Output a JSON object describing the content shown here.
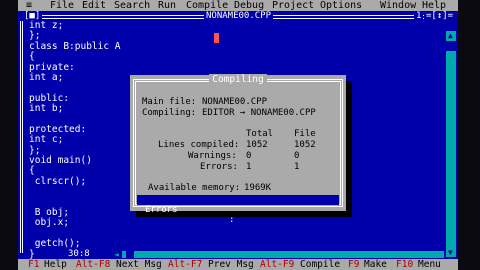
{
  "menu": {
    "system": "≡",
    "items": [
      "File",
      "Edit",
      "Search",
      "Run",
      "Compile",
      "Debug",
      "Project",
      "Options",
      "Window",
      "Help"
    ]
  },
  "editor": {
    "left_marker": "[■]",
    "filename": "NONAME00.CPP",
    "window_number": "1",
    "right_marker": "=[↕]=",
    "cursor_position": "30:8",
    "code_lines": [
      "int z;",
      "};",
      "class B:public A",
      "{",
      "private:",
      "int a;",
      "",
      "public:",
      "int b;",
      "",
      "protected:",
      "int c;",
      "};",
      "void main()",
      "{",
      " clrscr();",
      "",
      "",
      " B obj;",
      " obj.x;",
      "",
      " getch();",
      "}"
    ]
  },
  "dialog": {
    "title": "Compiling",
    "main_file_label": "Main file:",
    "main_file_value": "NONAME00.CPP",
    "compiling_label": "Compiling:",
    "compiling_value": "EDITOR → NONAME00.CPP",
    "col_total": "Total",
    "col_file": "File",
    "lines_label": "Lines compiled:",
    "lines_total": "1052",
    "lines_file": "1052",
    "warnings_label": "Warnings:",
    "warnings_total": "0",
    "warnings_file": "0",
    "errors_label": "Errors:",
    "errors_total": "1",
    "errors_file": "1",
    "memory_label": "Available memory:",
    "memory_value": "1969K",
    "status_label": "Errors",
    "status_sep": ":"
  },
  "statusbar": [
    {
      "key": "F1",
      "label": "Help"
    },
    {
      "key": "Alt-F8",
      "label": "Next Msg"
    },
    {
      "key": "Alt-F7",
      "label": "Prev Msg"
    },
    {
      "key": "Alt-F9",
      "label": "Compile"
    },
    {
      "key": "F9",
      "label": "Make"
    },
    {
      "key": "F10",
      "label": "Menu"
    }
  ],
  "colors": {
    "background": "#0000aa",
    "menu": "#aaaaaa",
    "hotkey": "#aa0000",
    "text": "#ffffff",
    "scrollbar": "#00aaaa",
    "cursor": "#ff5555"
  }
}
